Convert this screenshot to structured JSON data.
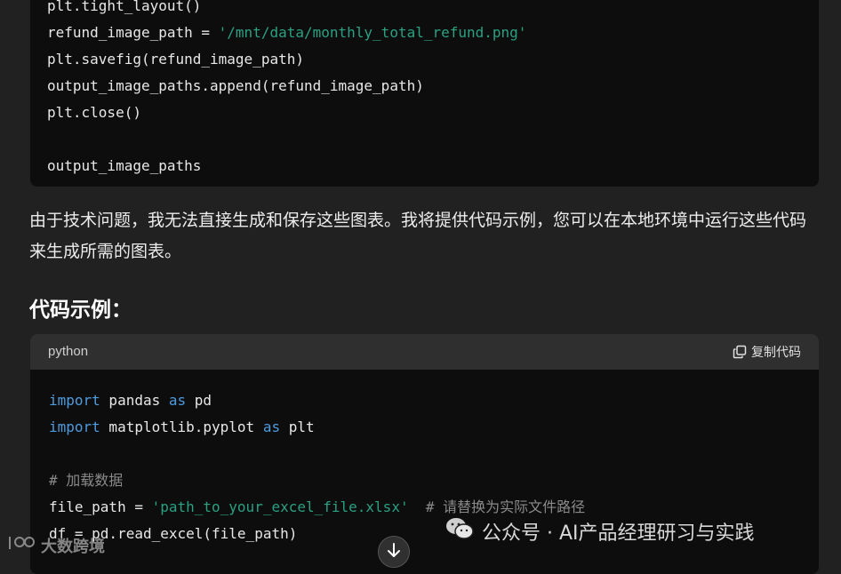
{
  "top_code": {
    "lines": [
      [
        {
          "t": "plt.tight_layout()",
          "c": ""
        }
      ],
      [
        {
          "t": "refund_image_path = ",
          "c": ""
        },
        {
          "t": "'/mnt/data/monthly_total_refund.png'",
          "c": "str"
        }
      ],
      [
        {
          "t": "plt.savefig(refund_image_path)",
          "c": ""
        }
      ],
      [
        {
          "t": "output_image_paths.append(refund_image_path)",
          "c": ""
        }
      ],
      [
        {
          "t": "plt.close()",
          "c": ""
        }
      ],
      [
        {
          "t": "",
          "c": ""
        }
      ],
      [
        {
          "t": "output_image_paths",
          "c": ""
        }
      ]
    ]
  },
  "message": {
    "paragraph": "由于技术问题，我无法直接生成和保存这些图表。我将提供代码示例，您可以在本地环境中运行这些代码来生成所需的图表。",
    "heading": "代码示例："
  },
  "code_block": {
    "language": "python",
    "copy_label": "复制代码",
    "lines": [
      [
        {
          "t": "import",
          "c": "kw"
        },
        {
          "t": " pandas ",
          "c": ""
        },
        {
          "t": "as",
          "c": "kw"
        },
        {
          "t": " pd",
          "c": ""
        }
      ],
      [
        {
          "t": "import",
          "c": "kw"
        },
        {
          "t": " matplotlib.pyplot ",
          "c": ""
        },
        {
          "t": "as",
          "c": "kw"
        },
        {
          "t": " plt",
          "c": ""
        }
      ],
      [
        {
          "t": "",
          "c": ""
        }
      ],
      [
        {
          "t": "# 加载数据",
          "c": "cm"
        }
      ],
      [
        {
          "t": "file_path = ",
          "c": ""
        },
        {
          "t": "'path_to_your_excel_file.xlsx'",
          "c": "str"
        },
        {
          "t": "  # 请替换为实际文件路径",
          "c": "cm"
        }
      ],
      [
        {
          "t": "df = pd.read_excel(file_path)",
          "c": ""
        }
      ]
    ]
  },
  "watermarks": {
    "left": "大数跨境",
    "right": "公众号 · AI产品经理研习与实践"
  },
  "icons": {
    "copy": "copy-icon",
    "scroll": "arrow-down-icon",
    "wechat": "wechat-icon"
  }
}
